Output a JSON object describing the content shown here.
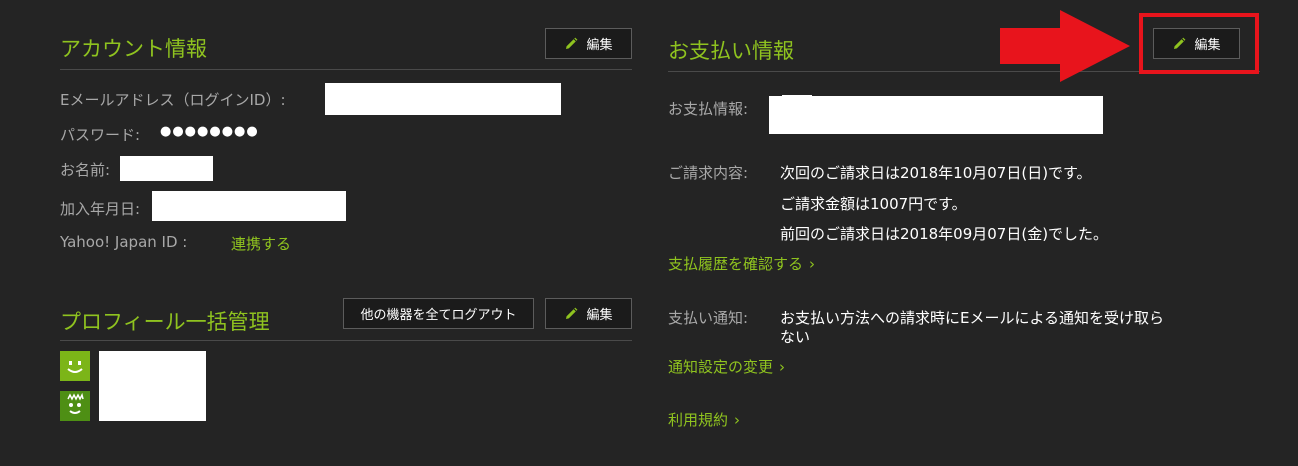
{
  "account": {
    "title": "アカウント情報",
    "edit_label": "編集",
    "email_label": "Eメールアドレス（ログインID）:",
    "password_label": "パスワード:",
    "password_value": "●●●●●●●●",
    "name_label": "お名前:",
    "joined_label": "加入年月日:",
    "yahoo_label": "Yahoo! Japan ID :",
    "yahoo_link": "連携する"
  },
  "profile": {
    "title": "プロフィール一括管理",
    "logout_all_label": "他の機器を全てログアウト",
    "edit_label": "編集"
  },
  "payment": {
    "title": "お支払い情報",
    "edit_label": "編集",
    "info_label": "お支払情報:",
    "billing_label": "ご請求内容:",
    "billing_lines": [
      "次回のご請求日は2018年10月07日(日)です。",
      "ご請求金額は1007円です。",
      "前回のご請求日は2018年09月07日(金)でした。"
    ],
    "history_link": "支払履歴を確認する",
    "notify_label": "支払い通知:",
    "notify_text_line1": "お支払い方法への請求時にEメールによる通知を受け取ら",
    "notify_text_line2": "ない",
    "notify_link": "通知設定の変更",
    "terms_link": "利用規約"
  },
  "colors": {
    "accent": "#8fc31f",
    "background": "#242424",
    "annotation": "#e8141c"
  }
}
